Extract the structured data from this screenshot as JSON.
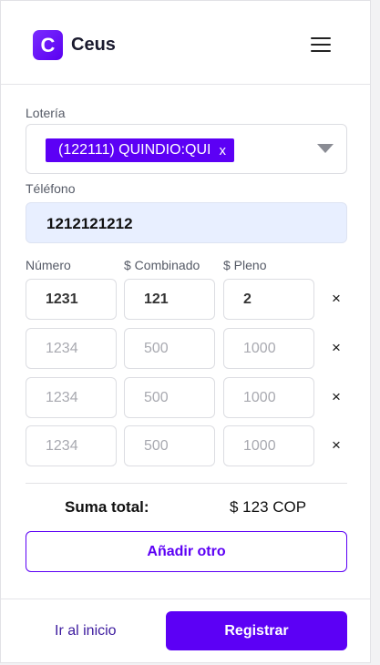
{
  "brand": {
    "logo_letter": "C",
    "name": "Ceus",
    "accent": "#5c00f5"
  },
  "header": {
    "menu_icon": "hamburger-menu-icon"
  },
  "form": {
    "lottery_label": "Lotería",
    "lottery_selected": "(122111) QUINDIO:QUI",
    "chip_remove": "x",
    "phone_label": "Téléfono",
    "phone_value": "1212121212",
    "columns": {
      "numero": "Número",
      "combinado": "$ Combinado",
      "pleno": "$ Pleno"
    },
    "rows": [
      {
        "numero": "1231",
        "combinado": "121",
        "pleno": "2",
        "filled": true
      },
      {
        "numero": "1234",
        "combinado": "500",
        "pleno": "1000",
        "filled": false
      },
      {
        "numero": "1234",
        "combinado": "500",
        "pleno": "1000",
        "filled": false
      },
      {
        "numero": "1234",
        "combinado": "500",
        "pleno": "1000",
        "filled": false
      }
    ],
    "remove_symbol": "×",
    "total_label": "Suma total:",
    "total_value": "$ 123 COP",
    "add_button": "Añadir otro"
  },
  "footer": {
    "home_link": "Ir al inicio",
    "register_button": "Registrar"
  }
}
